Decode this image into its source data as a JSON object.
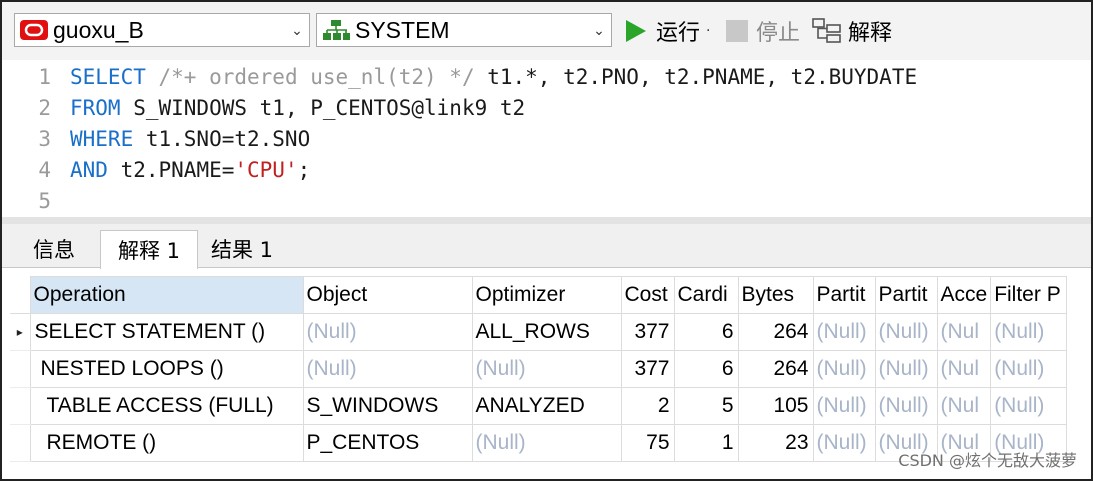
{
  "toolbar": {
    "connection": "guoxu_B",
    "schema": "SYSTEM",
    "run_label": "运行",
    "run_dot": "·",
    "stop_label": "停止",
    "explain_label": "解释",
    "icons": {
      "connection": "oracle-db-icon",
      "schema": "schema-tree-icon",
      "run": "play-icon",
      "stop": "stop-icon",
      "explain": "explain-plan-icon"
    }
  },
  "editor": {
    "lines": [
      {
        "num": "1",
        "parts": [
          [
            "kw",
            "SELECT"
          ],
          [
            "tx",
            " "
          ],
          [
            "cm",
            "/*+ ordered use_nl(t2) */"
          ],
          [
            "tx",
            " t1.*, t2.PNO, t2.PNAME, t2.BUYDATE"
          ]
        ]
      },
      {
        "num": "2",
        "parts": [
          [
            "kw",
            "FROM"
          ],
          [
            "tx",
            " S_WINDOWS t1, P_CENTOS@link9 t2"
          ]
        ]
      },
      {
        "num": "3",
        "parts": [
          [
            "kw",
            "WHERE"
          ],
          [
            "tx",
            " t1.SNO=t2.SNO"
          ]
        ]
      },
      {
        "num": "4",
        "parts": [
          [
            "kw",
            "AND"
          ],
          [
            "tx",
            " t2.PNAME="
          ],
          [
            "str",
            "'CPU'"
          ],
          [
            "tx",
            ";"
          ]
        ]
      },
      {
        "num": "5",
        "parts": []
      }
    ]
  },
  "tabs": [
    {
      "label": "信息"
    },
    {
      "label": "解释 1"
    },
    {
      "label": "结果 1"
    }
  ],
  "grid": {
    "columns": [
      "Operation",
      "Object",
      "Optimizer",
      "Cost",
      "Cardi",
      "Bytes",
      "Partit",
      "Partit",
      "Acce",
      "Filter P"
    ],
    "rows": [
      [
        "SELECT STATEMENT ()",
        "(Null)",
        "ALL_ROWS",
        "377",
        "6",
        "264",
        "(Null)",
        "(Null)",
        "(Nul",
        "(Null)"
      ],
      [
        "NESTED LOOPS ()",
        "(Null)",
        "(Null)",
        "377",
        "6",
        "264",
        "(Null)",
        "(Null)",
        "(Nul",
        "(Null)"
      ],
      [
        "TABLE ACCESS (FULL)",
        "S_WINDOWS",
        "ANALYZED",
        "2",
        "5",
        "105",
        "(Null)",
        "(Null)",
        "(Nul",
        "(Null)"
      ],
      [
        "REMOTE ()",
        "P_CENTOS",
        "(Null)",
        "75",
        "1",
        "23",
        "(Null)",
        "(Null)",
        "(Nul",
        "(Null)"
      ]
    ],
    "current_row_marker": "▸"
  },
  "watermark": "CSDN @炫个无敌大菠萝",
  "colors": {
    "keyword": "#1a6fc9",
    "comment": "#9a9a9a",
    "string": "#c02020",
    "null": "#a8b4c8",
    "run": "#2aa52a",
    "sorted_header": "#d6e6f5"
  }
}
